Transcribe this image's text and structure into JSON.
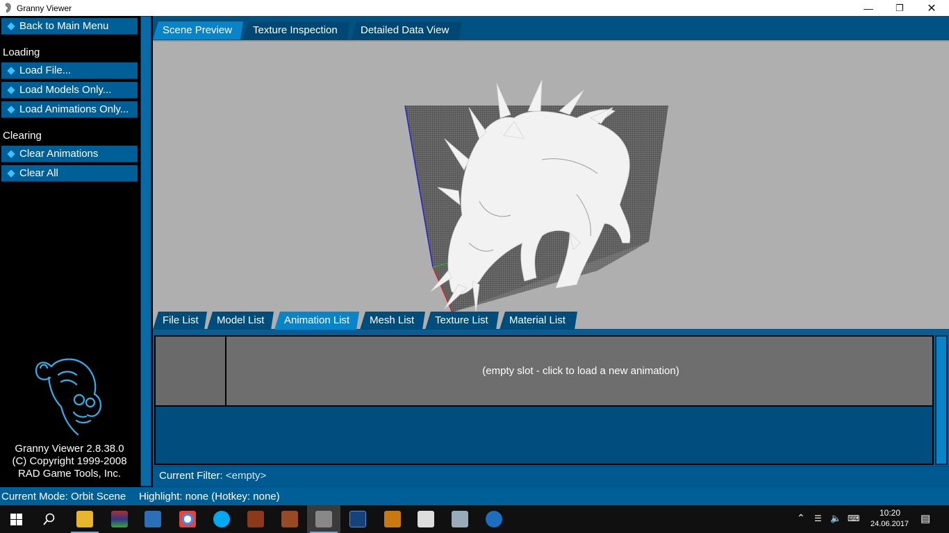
{
  "window": {
    "title": "Granny Viewer"
  },
  "sidebar": {
    "back_label": "Back to Main Menu",
    "loading_header": "Loading",
    "load_file": "Load File...",
    "load_models": "Load Models Only...",
    "load_animations": "Load Animations Only...",
    "clearing_header": "Clearing",
    "clear_animations": "Clear Animations",
    "clear_all": "Clear All",
    "version": "Granny Viewer 2.8.38.0",
    "copyright": "(C) Copyright 1999-2008",
    "company": "RAD Game Tools, Inc."
  },
  "top_tabs": [
    "Scene Preview",
    "Texture Inspection",
    "Detailed Data View"
  ],
  "active_top_tab": "Scene Preview",
  "bottom_tabs": [
    "File List",
    "Model List",
    "Animation List",
    "Mesh List",
    "Texture List",
    "Material List"
  ],
  "active_bottom_tab": "Animation List",
  "animation_slot": {
    "text": "(empty slot - click to load a new animation)"
  },
  "filter": {
    "label": "Current Filter:",
    "value": "<empty>"
  },
  "status": {
    "mode": "Current Mode: Orbit Scene",
    "highlight": "Highlight: none (Hotkey: none)"
  },
  "taskbar": {
    "time": "10:20",
    "date": "24.06.2017"
  },
  "colors": {
    "accent": "#005f96",
    "active_tab": "#0a84c8",
    "viewport_bg": "#afafaf"
  }
}
